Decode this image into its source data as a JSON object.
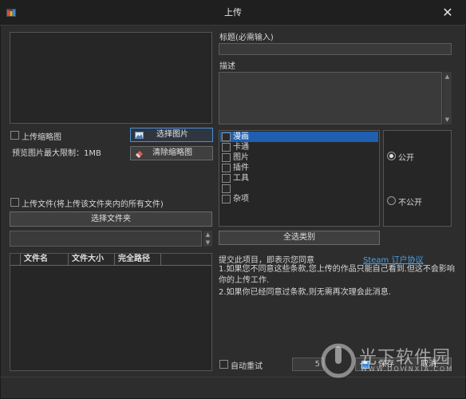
{
  "window": {
    "title": "上传"
  },
  "preview": {
    "thumb_checkbox_label": "上传缩略图",
    "size_limit": "预览图片最大限制：1MB",
    "select_image_btn": "选择图片",
    "clear_thumb_btn": "清除缩略图"
  },
  "upload_file": {
    "checkbox_label": "上传文件(将上传该文件夹内的所有文件)",
    "select_folder_btn": "选择文件夹",
    "columns": [
      "文件名",
      "文件大小",
      "完全路径"
    ]
  },
  "fields": {
    "title_label": "标题(必需输入)",
    "desc_label": "描述"
  },
  "categories": {
    "items": [
      "漫画",
      "卡通",
      "图片",
      "插件",
      "工具",
      "",
      "杂项"
    ],
    "selected_index": 0,
    "select_all_btn": "全选类别"
  },
  "visibility": {
    "public": "公开",
    "private": "不公开",
    "selected": "public"
  },
  "agreement": {
    "lead": "提交此项目，即表示您同意",
    "link": "Steam 订户协议",
    "line1": "1.如果您不同意这些条款,您上传的作品只能自己看到.但这不会影响你的上传工作.",
    "line2": "2.如果你已经同意过条款,则无需再次理会此消息."
  },
  "footer": {
    "auto_retry": "自动重试",
    "retry_value": "5",
    "save_btn": "保存",
    "cancel_btn": "取消"
  },
  "watermark": {
    "main": "光下软件园",
    "url": "WWW.DOWNXIA.COM"
  }
}
